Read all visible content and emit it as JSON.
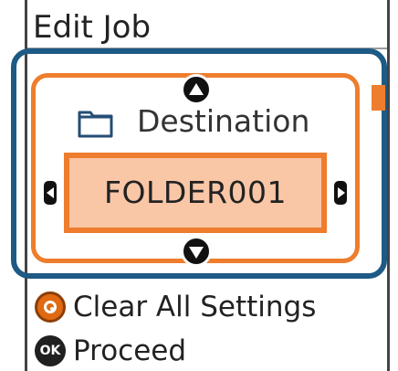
{
  "header": {
    "title": "Edit Job"
  },
  "setting": {
    "label": "Destination",
    "value": "FOLDER001",
    "icon": "folder-icon"
  },
  "footer": {
    "clear_label": "Clear All Settings",
    "proceed_label": "Proceed",
    "ok_icon_text": "OK"
  },
  "colors": {
    "focus_blue": "#1d5a85",
    "accent_orange": "#ee7d2d",
    "selection_fill": "#f9c6a6"
  }
}
